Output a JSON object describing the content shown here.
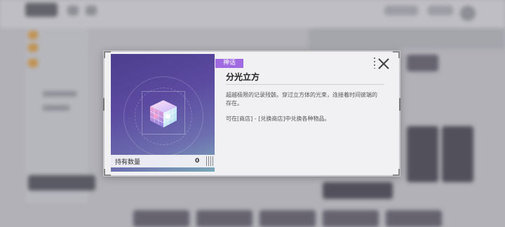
{
  "item": {
    "rarity": "神话",
    "name": "分光立方",
    "description": "超越极限的记录残骸。穿过立方体的光束，连接着时间彼端的存在。",
    "source": "可在[商店] - [兑换商店]中兑换各种物品。",
    "quantity_label": "持有数量",
    "quantity": "0",
    "icon": "prism-cube-icon"
  },
  "colors": {
    "rarity_badge": "#a06be0",
    "panel_top": "#4d3e8e",
    "panel_bottom": "#7aa9b8"
  }
}
